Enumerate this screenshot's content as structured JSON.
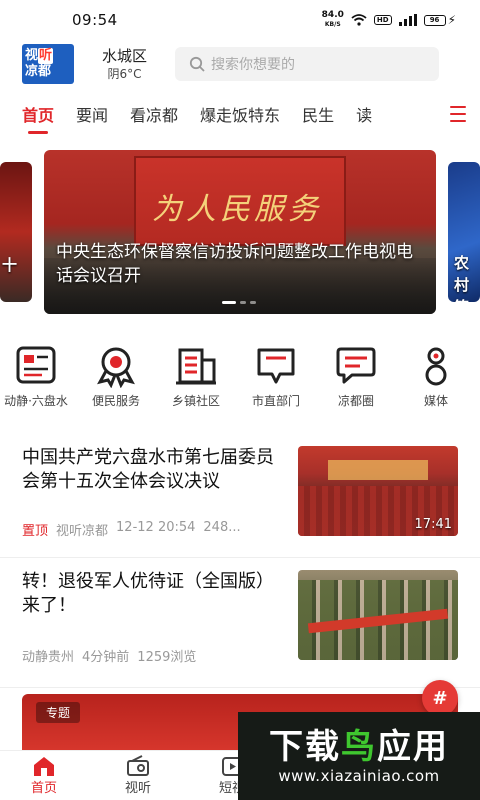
{
  "status": {
    "time": "09:54",
    "net_speed": "84.0",
    "net_unit": "KB/S",
    "hd": "HD",
    "battery": "96"
  },
  "header": {
    "logo_line1_a": "视",
    "logo_line1_b": "听",
    "logo_line2_a": "凉",
    "logo_line2_b": "都",
    "city": "水城区",
    "weather": "阴6°C",
    "search_placeholder": "搜索你想要的"
  },
  "nav": {
    "tabs": [
      "首页",
      "要闻",
      "看凉都",
      "爆走饭特东",
      "民生",
      "读"
    ]
  },
  "carousel": {
    "left_peek": "十",
    "banner_calligraphy": "为人民服务",
    "main_title": "中央生态环保督察信访投诉问题整改工作电视电话会议召开",
    "right_peek": "农村答案"
  },
  "services": [
    {
      "label": "动静·六盘水",
      "icon": "news-board-icon"
    },
    {
      "label": "便民服务",
      "icon": "service-badge-icon"
    },
    {
      "label": "乡镇社区",
      "icon": "building-icon"
    },
    {
      "label": "市直部门",
      "icon": "message-box-icon"
    },
    {
      "label": "凉都圈",
      "icon": "chat-bubble-icon"
    },
    {
      "label": "媒体",
      "icon": "media-icon"
    }
  ],
  "news": [
    {
      "title": "中国共产党六盘水市第七届委员会第十五次全体会议决议",
      "tag": "置顶",
      "source": "视听凉都",
      "time": "12-12 20:54",
      "views": "248...",
      "duration": "17:41"
    },
    {
      "title": "转！退役军人优待证（全国版）来了！",
      "source": "动静贵州",
      "time": "4分钟前",
      "views": "1259浏览"
    }
  ],
  "feature": {
    "tag": "专题"
  },
  "fab_label": "#",
  "bottom_nav": [
    {
      "label": "首页",
      "icon": "home-icon"
    },
    {
      "label": "视听",
      "icon": "radio-icon"
    },
    {
      "label": "短视",
      "icon": "short-video-icon"
    }
  ],
  "watermark": {
    "title_a": "下载",
    "title_b": "鸟",
    "title_c": "应用",
    "url": "www.xiazainiao.com"
  },
  "colors": {
    "accent": "#e0262a",
    "logo_blue": "#1e5fbf",
    "watermark_green": "#3fc72f"
  }
}
